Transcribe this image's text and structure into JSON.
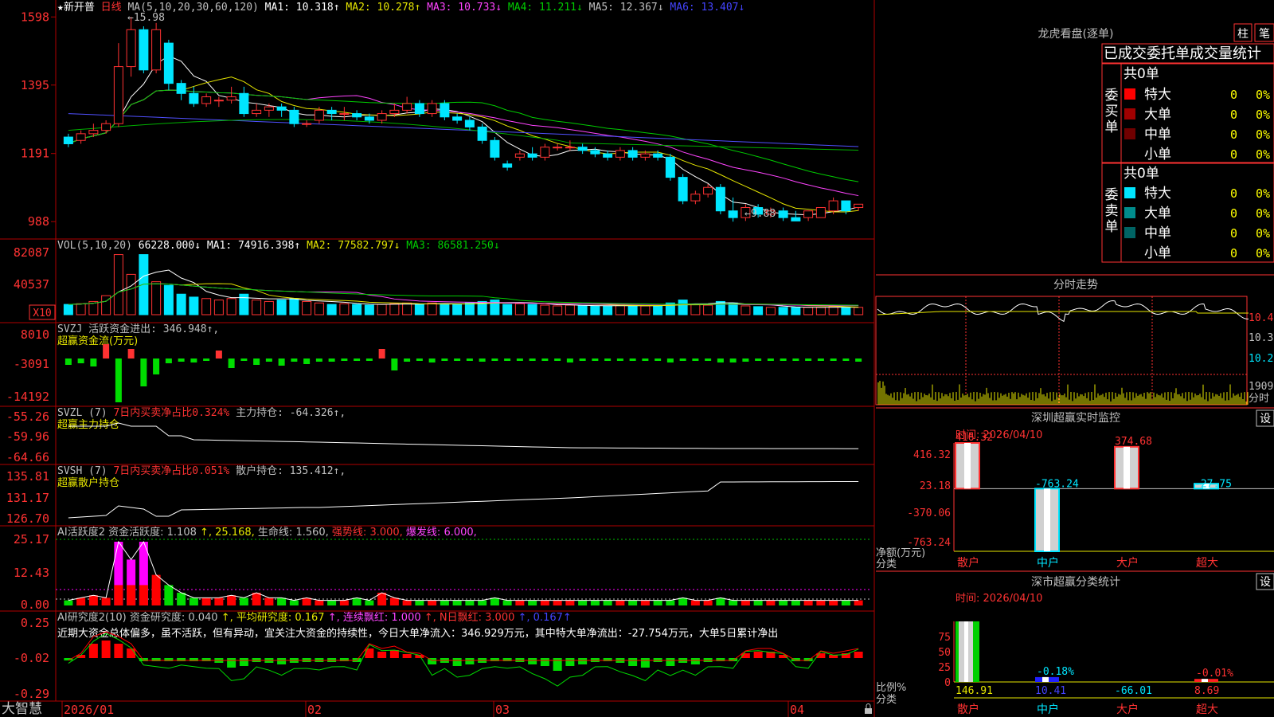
{
  "app": {
    "brand": "大智慧",
    "lock_icon": "lock-icon"
  },
  "colors": {
    "up": "#ff3232",
    "down": "#00e6ff",
    "ma1": "#ffffff",
    "ma2": "#e6e600",
    "ma3": "#ff44ff",
    "ma4": "#00cc00",
    "ma5": "#6666ff",
    "grid": "#b00000",
    "label": "#c0c0c0",
    "dashed_green": "#00c000",
    "dashed_magenta": "#ff00ff",
    "yellow": "#e6e600"
  },
  "price": {
    "stock_name": "★新开普",
    "period": "日线",
    "ma_label": "MA(5,10,20,30,60,120)",
    "ma_values": [
      {
        "label": "MA1: 10.318",
        "arrow": "↑",
        "color": "#ffffff"
      },
      {
        "label": "MA2: 10.278",
        "arrow": "↑",
        "color": "#e6e600"
      },
      {
        "label": "MA3: 10.733",
        "arrow": "↓",
        "color": "#ff44ff"
      },
      {
        "label": "MA4: 11.211",
        "arrow": "↓",
        "color": "#00cc00"
      },
      {
        "label": "MA5: 12.367",
        "arrow": "↓",
        "color": "#c0c0c0"
      },
      {
        "label": "MA6: 13.407",
        "arrow": "↓",
        "color": "#4444ff"
      }
    ],
    "y_ticks": [
      "1598",
      "1395",
      "1191",
      "988"
    ],
    "y_tick_values": [
      15.98,
      13.95,
      11.91,
      9.88
    ],
    "ylim": [
      9.6,
      16.2
    ],
    "high_label": "←15.98",
    "low_label": "←9.88"
  },
  "volume": {
    "label": "VOL(5,10,20)",
    "value": "66228.000↓",
    "ma": [
      {
        "label": "MA1: 74916.398",
        "arrow": "↑",
        "color": "#ffffff"
      },
      {
        "label": "MA2: 77582.797",
        "arrow": "↓",
        "color": "#e6e600"
      },
      {
        "label": "MA3: 86581.250",
        "arrow": "↓",
        "color": "#00cc00"
      }
    ],
    "y_ticks": [
      "82087",
      "40537"
    ],
    "unit": "X10"
  },
  "svzj": {
    "label": "SVZJ  活跃资金进出: 346.948↑,",
    "sub": "超赢资金流(万元)",
    "y_ticks": [
      "8010",
      "-3091",
      "-14192"
    ]
  },
  "svzl": {
    "label_a": "SVZL (7)",
    "label_b": "7日内买卖净占比0.324%",
    "label_c": "主力持仓: -64.326↑,",
    "sub": "超赢主力持仓",
    "y_ticks": [
      "-55.26",
      "-59.96",
      "-64.66"
    ]
  },
  "svsh": {
    "label_a": "SVSH (7)",
    "label_b": "7日内买卖净占比0.051%",
    "label_c": "散户持仓: 135.412↑,",
    "sub": "超赢散户持仓",
    "y_ticks": [
      "135.81",
      "131.17",
      "126.70"
    ]
  },
  "ai_active": {
    "label": "AI活跃度2",
    "parts": [
      {
        "text": "资金活跃度: 1.108",
        "color": "#c0c0c0"
      },
      {
        "text": "↑, 25.168,",
        "color": "#e6e600"
      },
      {
        "text": "生命线: 1.560,",
        "color": "#c0c0c0"
      },
      {
        "text": "强势线: 3.000,",
        "color": "#ff3232"
      },
      {
        "text": "爆发线: 6.000,",
        "color": "#ff44ff"
      }
    ],
    "y_ticks": [
      "25.17",
      "12.43",
      "0.00"
    ]
  },
  "ai_research": {
    "label": "AI研究度2(10)",
    "parts": [
      {
        "text": "资金研究度: 0.040",
        "color": "#c0c0c0"
      },
      {
        "text": "↑, 平均研究度: 0.167",
        "color": "#e6e600"
      },
      {
        "text": "↑, 连续飘红: 1.000",
        "color": "#ff44ff"
      },
      {
        "text": "↑, N日飘红: 3.000",
        "color": "#ff3232"
      },
      {
        "text": "↑, 0.167↑",
        "color": "#4444ff"
      }
    ],
    "comment": "近期大资金总体偏多，虽不活跃，但有异动，宜关注大资金的持续性，今日大单净流入：346.929万元，其中特大单净流出：-27.754万元，大单5日累计净出",
    "y_ticks": [
      "0.25",
      "-0.02",
      "-0.29"
    ]
  },
  "x_axis": {
    "labels": [
      "2026/01",
      "02",
      "03",
      "04"
    ]
  },
  "dragon_tiger": {
    "title": "龙虎看盘(逐单)",
    "btn_col": "柱",
    "btn_pen": "笔",
    "header": "已成交委托单成交量统计",
    "buy_label": "委买单",
    "sell_label": "委卖单",
    "buy_total": "共0单",
    "sell_total": "共0单",
    "buy_rows": [
      {
        "label": "特大",
        "count": "0",
        "pct": "0%",
        "color": "#ff0000"
      },
      {
        "label": "大单",
        "count": "0",
        "pct": "0%",
        "color": "#a00000"
      },
      {
        "label": "中单",
        "count": "0",
        "pct": "0%",
        "color": "#700000"
      },
      {
        "label": "小单",
        "count": "0",
        "pct": "0%",
        "color": "#000000"
      }
    ],
    "sell_rows": [
      {
        "label": "特大",
        "count": "0",
        "pct": "0%",
        "color": "#00e6ff"
      },
      {
        "label": "大单",
        "count": "0",
        "pct": "0%",
        "color": "#008c8c"
      },
      {
        "label": "中单",
        "count": "0",
        "pct": "0%",
        "color": "#006464"
      },
      {
        "label": "小单",
        "count": "0",
        "pct": "0%",
        "color": "#000000"
      }
    ]
  },
  "intraday": {
    "title": "分时走势",
    "y_ticks": [
      "10.4",
      "10.31",
      "10.20"
    ],
    "vol_tick": "1909",
    "vol_label": "分时"
  },
  "sz_monitor": {
    "title": "深圳超赢实时监控",
    "set_btn": "设",
    "time": "时间: 2026/04/10",
    "y_ticks": [
      "416.32",
      "23.18",
      "-370.06",
      "-763.24"
    ],
    "ylim": [
      -763.24,
      416.32
    ],
    "axis_label_a": "净额(万元)",
    "axis_label_b": "分类",
    "categories": [
      "散户",
      "中户",
      "大户",
      "超大"
    ],
    "values": [
      416.32,
      -763.24,
      374.68,
      -27.75
    ],
    "value_labels": [
      "416.32",
      "-763.24",
      "374.68",
      "-27.75"
    ]
  },
  "sz_stats": {
    "title": "深市超赢分类统计",
    "set_btn": "设",
    "time": "时间: 2026/04/10",
    "y_ticks": [
      "75",
      "50",
      "25",
      "0"
    ],
    "ylim": [
      0,
      100
    ],
    "axis_label_a": "比例%",
    "axis_label_b": "分类",
    "categories": [
      "散户",
      "中户",
      "大户",
      "超大"
    ],
    "bar_values": [
      100,
      8,
      0,
      5
    ],
    "top_labels": [
      "",
      "-0.18%",
      "",
      "-0.01%"
    ],
    "bottom_labels": [
      "146.91",
      "10.41",
      "-66.01",
      "8.69"
    ]
  },
  "chart_data": [
    {
      "type": "candlestick",
      "title": "新开普 日线",
      "dates": [
        "2026/01",
        "02",
        "03",
        "04"
      ],
      "series": [
        {
          "name": "K线",
          "values": [
            [
              12.4,
              12.2,
              12.5,
              12.1
            ],
            [
              12.3,
              12.5,
              12.6,
              12.2
            ],
            [
              12.5,
              12.6,
              12.8,
              12.4
            ],
            [
              12.6,
              12.8,
              12.9,
              12.5
            ],
            [
              12.8,
              14.5,
              15.2,
              12.7
            ],
            [
              14.5,
              15.6,
              15.98,
              14.2
            ],
            [
              15.6,
              14.4,
              15.7,
              14.3
            ],
            [
              14.4,
              15.6,
              15.8,
              14.3
            ],
            [
              15.2,
              14.0,
              15.3,
              13.8
            ],
            [
              14.0,
              13.7,
              14.1,
              13.5
            ],
            [
              13.7,
              13.4,
              13.9,
              13.3
            ],
            [
              13.4,
              13.6,
              13.7,
              13.3
            ],
            [
              13.5,
              13.5,
              13.6,
              13.3
            ],
            [
              13.5,
              13.6,
              13.9,
              13.4
            ],
            [
              13.7,
              13.1,
              13.9,
              13.0
            ],
            [
              13.1,
              13.2,
              13.4,
              13.0
            ],
            [
              13.2,
              13.3,
              13.4,
              13.0
            ],
            [
              13.3,
              13.2,
              13.4,
              13.0
            ],
            [
              13.2,
              12.8,
              13.3,
              12.7
            ],
            [
              12.8,
              12.8,
              12.9,
              12.7
            ],
            [
              12.9,
              13.2,
              13.3,
              12.8
            ],
            [
              13.2,
              13.1,
              13.3,
              12.9
            ],
            [
              13.1,
              13.1,
              13.3,
              12.9
            ],
            [
              13.1,
              13.0,
              13.2,
              12.9
            ],
            [
              13.0,
              12.9,
              13.1,
              12.8
            ],
            [
              12.9,
              13.1,
              13.2,
              12.8
            ],
            [
              13.1,
              13.2,
              13.4,
              13.0
            ],
            [
              13.2,
              13.4,
              13.6,
              13.1
            ],
            [
              13.4,
              13.1,
              13.5,
              13.0
            ],
            [
              13.1,
              13.4,
              13.5,
              13.0
            ],
            [
              13.4,
              13.0,
              13.5,
              12.9
            ],
            [
              13.0,
              12.9,
              13.1,
              12.8
            ],
            [
              12.9,
              12.7,
              13.0,
              12.6
            ],
            [
              12.7,
              12.3,
              12.8,
              12.2
            ],
            [
              12.3,
              11.8,
              12.4,
              11.7
            ],
            [
              11.6,
              11.5,
              11.7,
              11.4
            ],
            [
              11.8,
              11.9,
              12.0,
              11.7
            ],
            [
              11.9,
              11.8,
              12.1,
              11.7
            ],
            [
              11.8,
              12.1,
              12.2,
              11.7
            ],
            [
              12.1,
              12.1,
              12.2,
              12.0
            ],
            [
              12.1,
              12.1,
              12.3,
              12.0
            ],
            [
              12.1,
              12.0,
              12.2,
              11.9
            ],
            [
              12.0,
              11.9,
              12.1,
              11.8
            ],
            [
              11.9,
              11.8,
              12.0,
              11.7
            ],
            [
              11.8,
              12.0,
              12.1,
              11.7
            ],
            [
              12.0,
              11.8,
              12.1,
              11.7
            ],
            [
              11.8,
              11.9,
              12.0,
              11.7
            ],
            [
              11.9,
              11.8,
              12.0,
              11.7
            ],
            [
              11.8,
              11.2,
              11.9,
              11.1
            ],
            [
              11.2,
              10.5,
              11.3,
              10.4
            ],
            [
              10.5,
              10.7,
              10.8,
              10.4
            ],
            [
              10.7,
              10.9,
              11.0,
              10.6
            ],
            [
              10.9,
              10.2,
              11.0,
              10.1
            ],
            [
              10.2,
              10.0,
              10.6,
              9.88
            ],
            [
              10.0,
              10.3,
              10.4,
              9.9
            ],
            [
              10.3,
              10.1,
              10.4,
              10.0
            ],
            [
              10.1,
              10.2,
              10.3,
              10.0
            ],
            [
              10.2,
              10.0,
              10.3,
              9.9
            ],
            [
              10.0,
              9.9,
              10.2,
              9.9
            ],
            [
              10.0,
              10.2,
              10.2,
              9.9
            ],
            [
              10.0,
              10.3,
              10.3,
              10.0
            ],
            [
              10.2,
              10.5,
              10.6,
              10.1
            ],
            [
              10.5,
              10.2,
              10.5,
              10.1
            ],
            [
              10.3,
              10.4,
              10.4,
              10.2
            ]
          ]
        }
      ],
      "ylim": [
        9.6,
        16.2
      ]
    }
  ]
}
